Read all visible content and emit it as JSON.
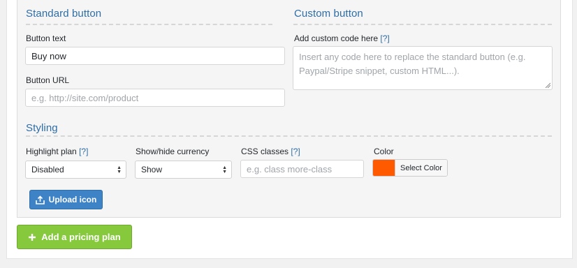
{
  "standard": {
    "title": "Standard button",
    "button_text_label": "Button text",
    "button_text_value": "Buy now",
    "button_url_label": "Button URL",
    "button_url_placeholder": "e.g. http://site.com/product"
  },
  "custom": {
    "title": "Custom button",
    "code_label": "Add custom code here",
    "help": "[?]",
    "code_placeholder": "Insert any code here to replace the standard button (e.g. Paypal/Stripe snippet, custom HTML...)."
  },
  "styling": {
    "title": "Styling",
    "highlight_label": "Highlight plan",
    "highlight_help": "[?]",
    "highlight_value": "Disabled",
    "currency_label": "Show/hide currency",
    "currency_value": "Show",
    "css_label": "CSS classes",
    "css_help": "[?]",
    "css_placeholder": "e.g. class more-class",
    "color_label": "Color",
    "color_button": "Select Color",
    "color_value": "#ff5a00"
  },
  "actions": {
    "upload_label": "Upload icon",
    "add_plan_label": "Add a pricing plan"
  },
  "colors": {
    "accent": "#2f6da5",
    "upload_bg": "#3d83c5",
    "add_bg": "#86c93c"
  }
}
